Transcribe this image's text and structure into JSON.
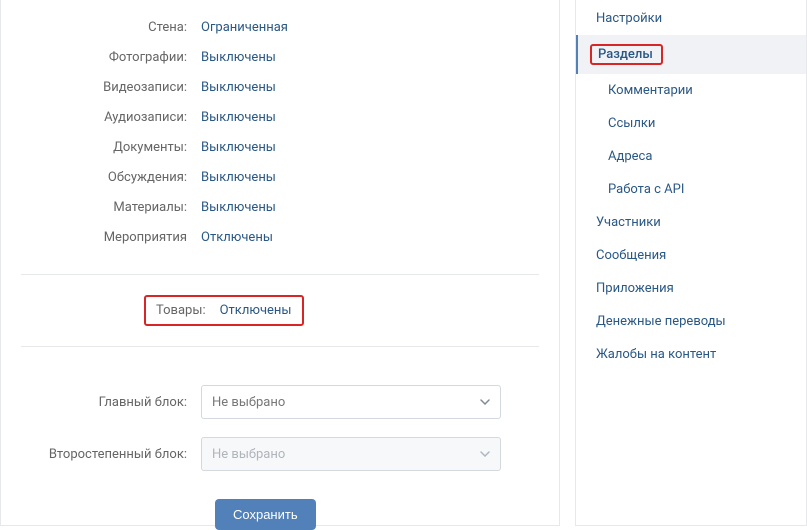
{
  "settings": {
    "rows": [
      {
        "label": "Стена:",
        "value": "Ограниченная"
      },
      {
        "label": "Фотографии:",
        "value": "Выключены"
      },
      {
        "label": "Видеозаписи:",
        "value": "Выключены"
      },
      {
        "label": "Аудиозаписи:",
        "value": "Выключены"
      },
      {
        "label": "Документы:",
        "value": "Выключены"
      },
      {
        "label": "Обсуждения:",
        "value": "Выключены"
      },
      {
        "label": "Материалы:",
        "value": "Выключены"
      },
      {
        "label": "Мероприятия",
        "value": "Отключены"
      }
    ],
    "tovary": {
      "label": "Товары:",
      "value": "Отключены"
    },
    "main_block": {
      "label": "Главный блок:",
      "placeholder": "Не выбрано"
    },
    "secondary_block": {
      "label": "Второстепенный блок:",
      "placeholder": "Не выбрано"
    },
    "save": "Сохранить"
  },
  "nav": {
    "settings": "Настройки",
    "sections": "Разделы",
    "sub": {
      "comments": "Комментарии",
      "links": "Ссылки",
      "addresses": "Адреса",
      "api": "Работа с API"
    },
    "members": "Участники",
    "messages": "Сообщения",
    "apps": "Приложения",
    "money": "Денежные переводы",
    "complaints": "Жалобы на контент"
  }
}
